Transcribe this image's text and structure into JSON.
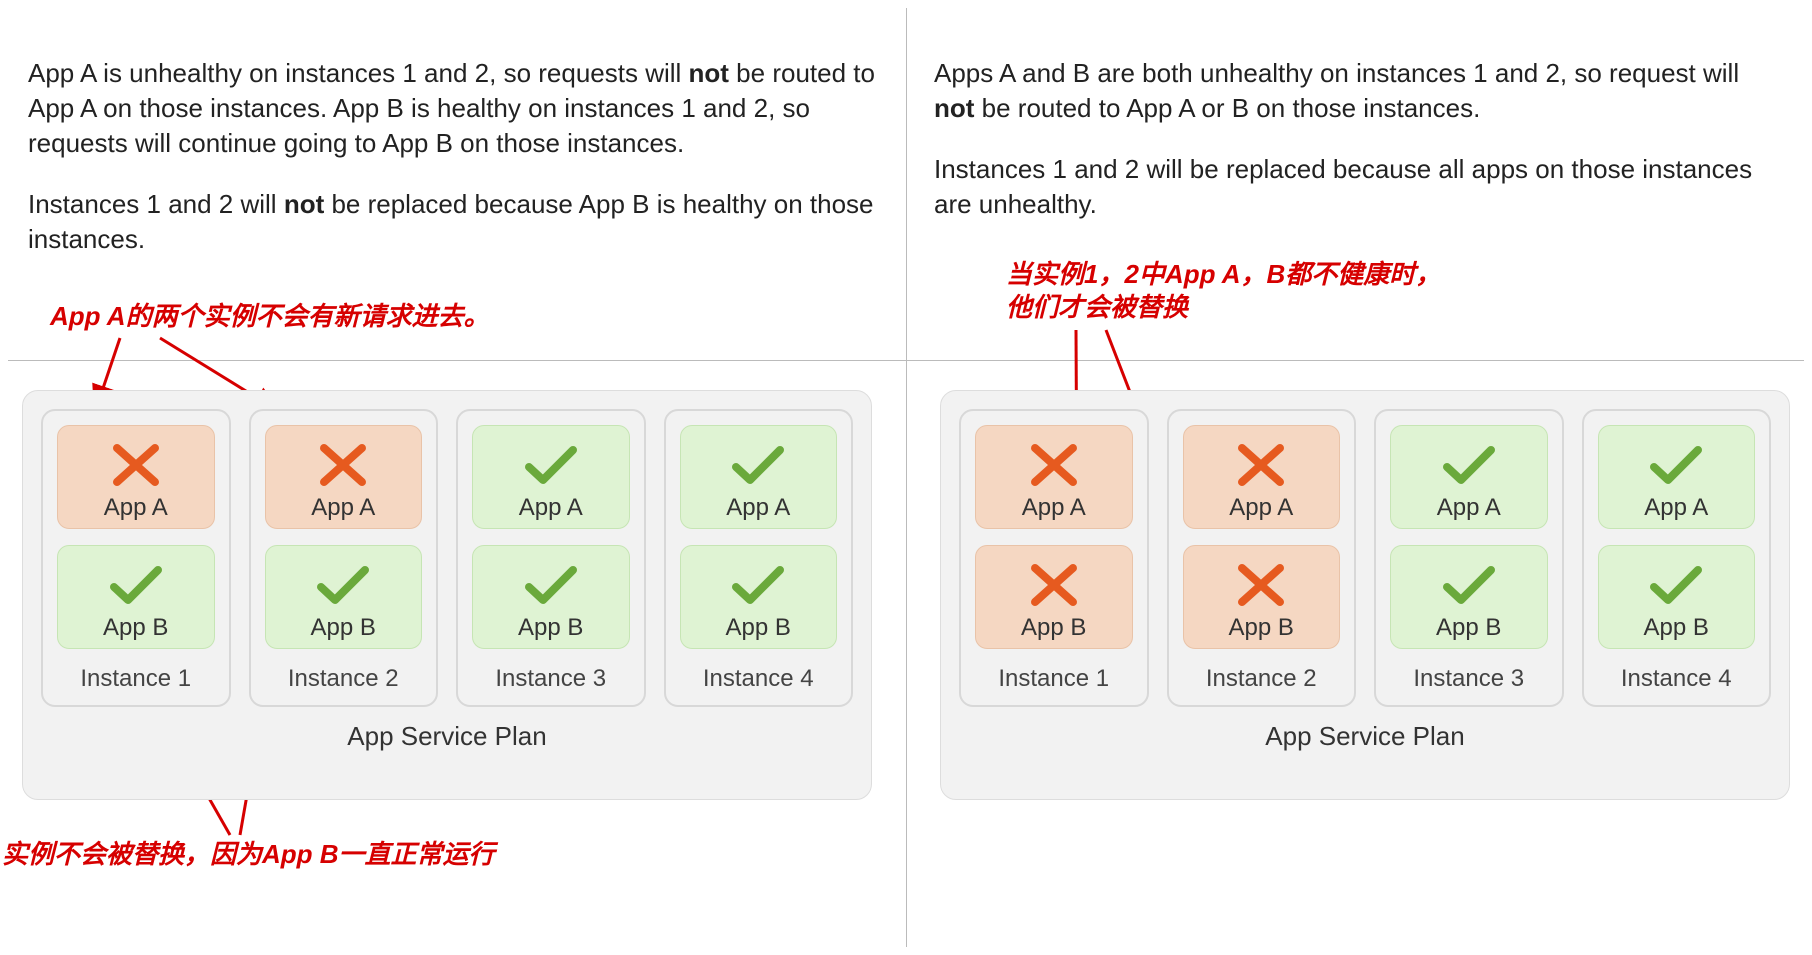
{
  "left": {
    "desc1_pre": "App A is unhealthy on instances 1 and 2, so requests will ",
    "desc1_bold": "not",
    "desc1_post": " be routed to App A on those instances. App B is healthy on instances 1 and 2, so requests will continue going to App B on those instances.",
    "desc2_pre": "Instances 1 and 2 will ",
    "desc2_bold": "not",
    "desc2_post": " be replaced because App B is healthy on those instances.",
    "anno_top": "App A的两个实例不会有新请求进去。",
    "anno_bottom": "实例不会被替换，因为App B一直正常运行",
    "plan_label": "App Service Plan",
    "instances": [
      {
        "label": "Instance 1",
        "apps": [
          {
            "name": "App A",
            "healthy": false
          },
          {
            "name": "App B",
            "healthy": true
          }
        ]
      },
      {
        "label": "Instance 2",
        "apps": [
          {
            "name": "App A",
            "healthy": false
          },
          {
            "name": "App B",
            "healthy": true
          }
        ]
      },
      {
        "label": "Instance 3",
        "apps": [
          {
            "name": "App A",
            "healthy": true
          },
          {
            "name": "App B",
            "healthy": true
          }
        ]
      },
      {
        "label": "Instance 4",
        "apps": [
          {
            "name": "App A",
            "healthy": true
          },
          {
            "name": "App B",
            "healthy": true
          }
        ]
      }
    ]
  },
  "right": {
    "desc1_pre": "Apps A and B are both unhealthy on instances 1 and 2, so request will ",
    "desc1_bold": "not",
    "desc1_post": " be routed to App A or B on those instances.",
    "desc2": "Instances 1 and 2 will be replaced because all apps on those instances are unhealthy.",
    "anno_top_line1": "当实例1，2中App A，B都不健康时，",
    "anno_top_line2": "他们才会被替换",
    "plan_label": "App Service Plan",
    "instances": [
      {
        "label": "Instance 1",
        "apps": [
          {
            "name": "App A",
            "healthy": false
          },
          {
            "name": "App B",
            "healthy": false
          }
        ]
      },
      {
        "label": "Instance 2",
        "apps": [
          {
            "name": "App A",
            "healthy": false
          },
          {
            "name": "App B",
            "healthy": false
          }
        ]
      },
      {
        "label": "Instance 3",
        "apps": [
          {
            "name": "App A",
            "healthy": true
          },
          {
            "name": "App B",
            "healthy": true
          }
        ]
      },
      {
        "label": "Instance 4",
        "apps": [
          {
            "name": "App A",
            "healthy": true
          },
          {
            "name": "App B",
            "healthy": true
          }
        ]
      }
    ]
  },
  "icons": {
    "cross_color": "#e65a1f",
    "check_color": "#6aa93b"
  }
}
